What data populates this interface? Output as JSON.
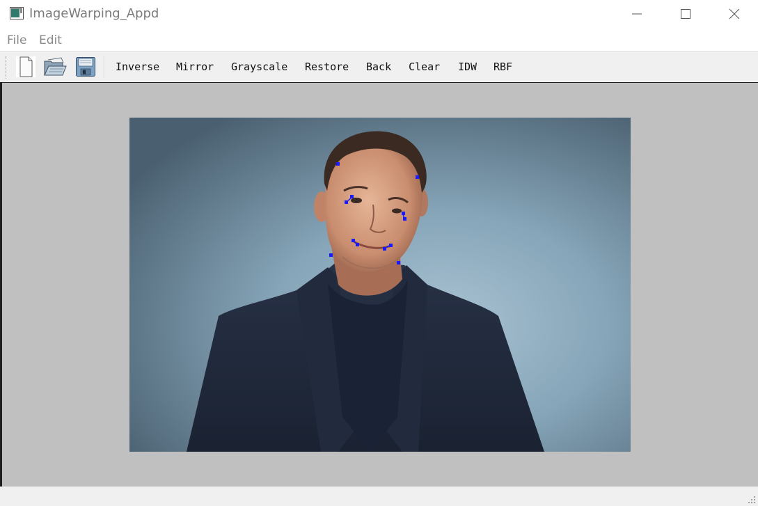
{
  "window": {
    "title": "ImageWarping_Appd"
  },
  "menu": {
    "file": "File",
    "edit": "Edit"
  },
  "toolbar": {
    "icons": [
      "new-file-icon",
      "open-folder-icon",
      "save-floppy-icon"
    ],
    "actions": {
      "inverse": "Inverse",
      "mirror": "Mirror",
      "grayscale": "Grayscale",
      "restore": "Restore",
      "back": "Back",
      "clear": "Clear",
      "idw": "IDW",
      "rbf": "RBF"
    }
  },
  "canvas": {
    "background_color": "#c0c0c0",
    "control_point_color": "#1a1aff"
  }
}
